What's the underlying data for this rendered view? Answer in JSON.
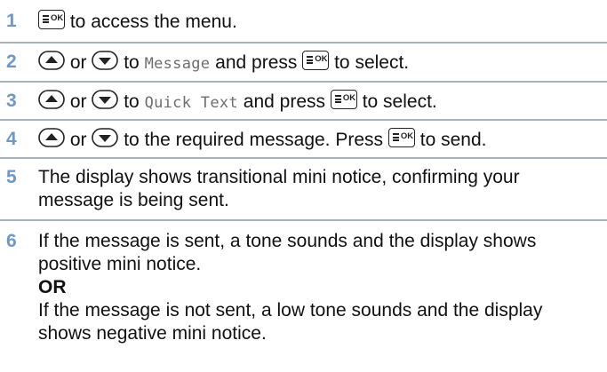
{
  "steps": [
    {
      "number": "1",
      "after_key": "to access the menu."
    },
    {
      "number": "2",
      "or": "or",
      "to": "to",
      "item": "Message",
      "and_press": "and press",
      "to_select": "to select."
    },
    {
      "number": "3",
      "or": "or",
      "to": "to",
      "item": "Quick Text",
      "and_press": "and press",
      "to_select": "to select."
    },
    {
      "number": "4",
      "or": "or",
      "text": "to the required message. Press",
      "to_send": "to send."
    },
    {
      "number": "5",
      "text": " The display shows transitional mini notice, confirming your message is being sent."
    },
    {
      "number": "6",
      "sent_text": "If the message is sent, a tone sounds and the display shows positive mini notice.",
      "or_label": "OR",
      "not_sent_text": "If the message is not sent, a low tone sounds and the display shows negative mini notice."
    }
  ],
  "keys": {
    "ok_key_label": "OK",
    "up_key_icon": "up-arrow-key-icon",
    "down_key_icon": "down-arrow-key-icon",
    "menu_ok_key_icon": "menu-ok-key-icon"
  },
  "colors": {
    "step_number": "#6f98c6",
    "divider": "#a9b2bf",
    "menu_item_text": "#6e6e6e"
  }
}
